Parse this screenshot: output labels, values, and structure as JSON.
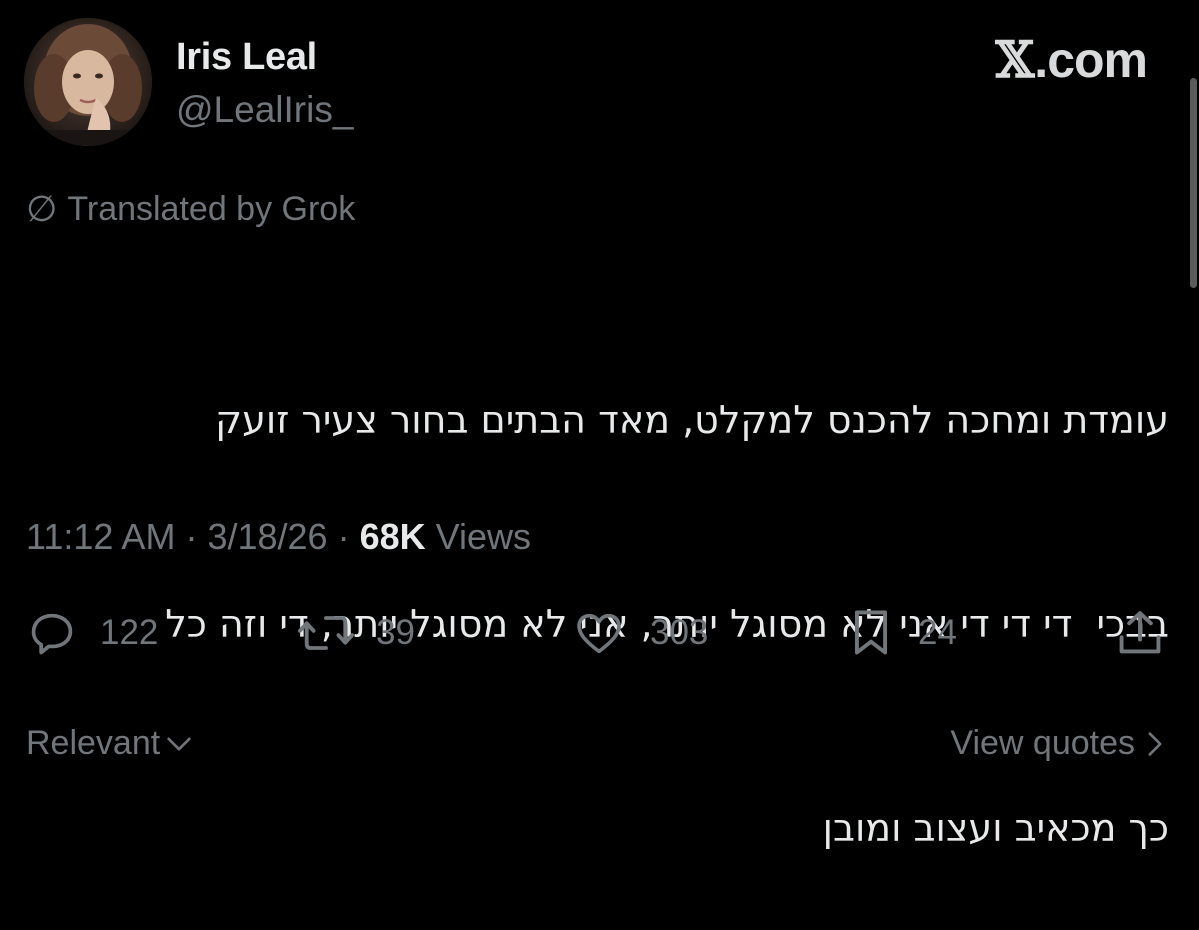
{
  "author": {
    "display_name": "Iris Leal",
    "handle": "@LealIris_",
    "avatar": "avatar-photo"
  },
  "brand": {
    "x_mark": "𝕏",
    "domain": ".com"
  },
  "translated": {
    "icon": "translate-slash-icon",
    "label": "Translated by Grok"
  },
  "tweet": {
    "lines": [
      "עומדת ומחכה להכנס למקלט, מאד הבתים בחור צעיר זועק",
      "בבכי  די די די אני לא מסוגל יותר, אני לא מסוגל יותר, די וזה כל",
      "כך מכאיב ועצוב ומובן"
    ]
  },
  "meta": {
    "time": "11:12 AM",
    "sep1": " · ",
    "date": "3/18/26",
    "sep2": " · ",
    "views_count": "68K",
    "views_label": " Views"
  },
  "actions": {
    "replies": "122",
    "reposts": "39",
    "likes": "303",
    "bookmarks": "24"
  },
  "footer": {
    "left_label": "Relevant",
    "left_icon": "chevron-down-icon",
    "right_label": "View quotes",
    "right_icon": "chevron-right-icon"
  },
  "colors": {
    "background": "#000000",
    "text": "#e7e9ea",
    "muted": "#71767b"
  }
}
